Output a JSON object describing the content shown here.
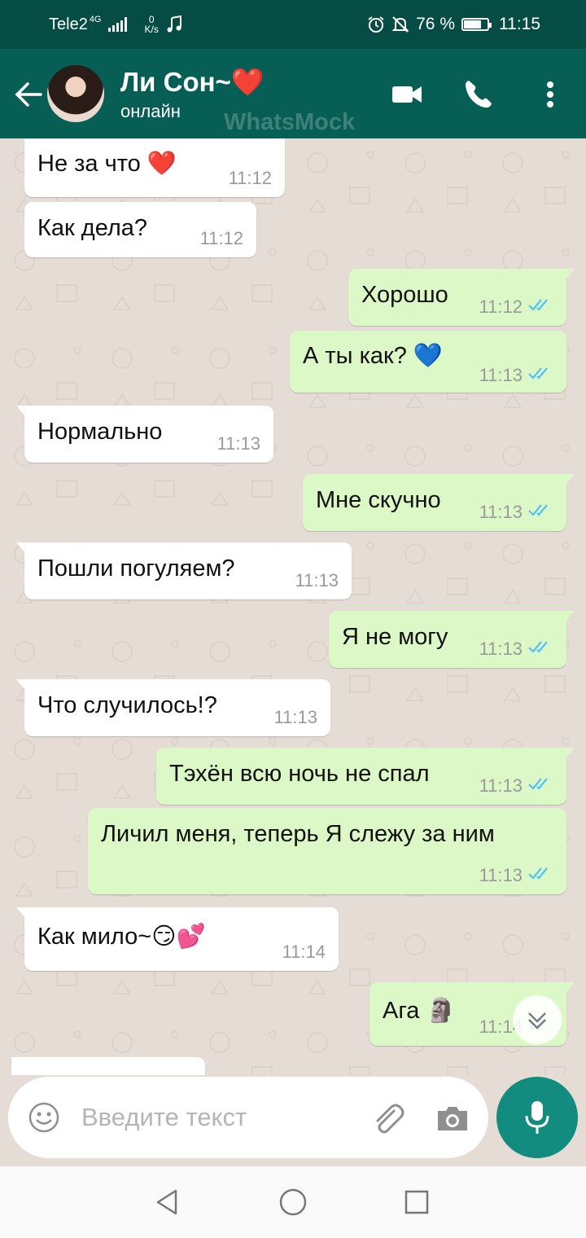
{
  "status_bar": {
    "carrier": "Tele2",
    "network": "4G",
    "speed_value": "0",
    "speed_unit": "K/s",
    "battery_percent": "76 %",
    "battery_level": 0.76,
    "time": "11:15",
    "icons": [
      "signal-icon",
      "music-note-icon",
      "alarm-icon",
      "mute-icon",
      "battery-icon"
    ]
  },
  "header": {
    "contact_name": "Ли Сон~❤️",
    "status": "онлайн",
    "watermark": "WhatsMock",
    "icons": [
      "back-arrow-icon",
      "video-call-icon",
      "phone-icon",
      "more-vert-icon"
    ]
  },
  "messages": [
    {
      "dir": "in",
      "text": "Не за что ❤️",
      "time": "11:12"
    },
    {
      "dir": "in",
      "text": "Как дела?",
      "time": "11:12"
    },
    {
      "dir": "out",
      "text": "Хорошо",
      "time": "11:12",
      "read": true
    },
    {
      "dir": "out",
      "text": "А ты как? 💙",
      "time": "11:13",
      "read": true
    },
    {
      "dir": "in",
      "text": "Нормально",
      "time": "11:13"
    },
    {
      "dir": "out",
      "text": "Мне скучно",
      "time": "11:13",
      "read": true
    },
    {
      "dir": "in",
      "text": "Пошли погуляем?",
      "time": "11:13"
    },
    {
      "dir": "out",
      "text": "Я не могу",
      "time": "11:13",
      "read": true
    },
    {
      "dir": "in",
      "text": "Что случилось!?",
      "time": "11:13"
    },
    {
      "dir": "out",
      "text": "Тэхён всю ночь не спал",
      "time": "11:13",
      "read": true
    },
    {
      "dir": "out",
      "text": "Личил меня, теперь Я слежу за ним",
      "time": "11:13",
      "read": true
    },
    {
      "dir": "in",
      "text": "Как мило~😏💕",
      "time": "11:14"
    },
    {
      "dir": "out",
      "text": "Ага 🗿",
      "time": "11:14",
      "read": true
    }
  ],
  "composer": {
    "placeholder": "Введите текст",
    "icons": [
      "emoji-icon",
      "attach-icon",
      "camera-icon",
      "mic-icon"
    ]
  },
  "colors": {
    "header": "#075e54",
    "status_bar": "#054d44",
    "outgoing_bubble": "#dcf8c6",
    "incoming_bubble": "#ffffff",
    "chat_background": "#e5ddd5",
    "read_ticks": "#4fc3f7",
    "mic_button": "#128c7e"
  }
}
